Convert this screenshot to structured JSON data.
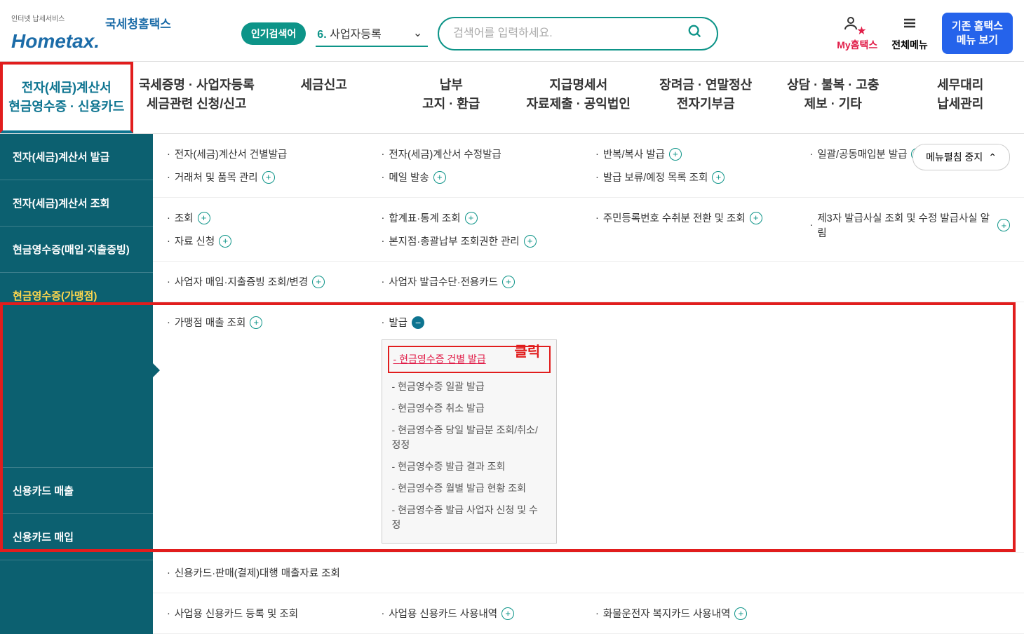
{
  "header": {
    "logo_main": "Hometax.",
    "logo_sub": "국세청홈택스",
    "logo_tag": "인터넷 납세서비스",
    "popular_badge": "인기검색어",
    "keyword_num": "6.",
    "keyword_text": "사업자등록",
    "search_placeholder": "검색어를 입력하세요.",
    "my_label": "My홈택스",
    "all_menu_label": "전체메뉴",
    "old_menu_line1": "기존 홈택스",
    "old_menu_line2": "메뉴 보기"
  },
  "nav": [
    "전자(세금)계산서\n현금영수증 · 신용카드",
    "국세증명 · 사업자등록\n세금관련 신청/신고",
    "세금신고",
    "납부\n고지 · 환급",
    "지급명세서\n자료제출 · 공익법인",
    "장려금 · 연말정산\n전자기부금",
    "상담 · 불복 · 고충\n제보 · 기타",
    "세무대리\n납세관리"
  ],
  "side": [
    "전자(세금)계산서 발급",
    "전자(세금)계산서 조회",
    "현금영수증(매입·지출증빙)",
    "현금영수증(가맹점)",
    "신용카드 매출",
    "신용카드 매입"
  ],
  "rows": {
    "r0": {
      "c0": [
        "전자(세금)계산서 건별발급",
        "거래처 및 품목 관리"
      ],
      "c1": [
        "전자(세금)계산서 수정발급",
        "메일 발송"
      ],
      "c2": [
        "반복/복사 발급",
        "발급 보류/예정 목록 조회"
      ],
      "c3": [
        "일괄/공동매입분 발급"
      ]
    },
    "r1": {
      "c0": [
        "조회",
        "자료 신청"
      ],
      "c1": [
        "합계표·통계 조회",
        "본지점·총괄납부 조회권한 관리"
      ],
      "c2": [
        "주민등록번호 수취분 전환 및 조회"
      ],
      "c3": [
        "제3자 발급사실 조회 및 수정 발급사실 알림"
      ]
    },
    "r2": {
      "c0": [
        "사업자 매입·지출증빙 조회/변경"
      ],
      "c1": [
        "사업자 발급수단·전용카드"
      ]
    },
    "r3": {
      "c0": [
        "가맹점 매출 조회"
      ],
      "c1_head": "발급",
      "dropdown": [
        "현금영수증 건별 발급",
        "현금영수증 일괄 발급",
        "현금영수증 취소 발급",
        "현금영수증 당일 발급분 조회/취소/정정",
        "현금영수증 발급 결과 조회",
        "현금영수증 월별 발급 현황 조회",
        "현금영수증 발급 사업자 신청 및 수정"
      ]
    },
    "r4": {
      "c0": [
        "신용카드·판매(결제)대행 매출자료 조회"
      ]
    },
    "r5": {
      "c0": [
        "사업용 신용카드 등록 및 조회"
      ],
      "c1": [
        "사업용 신용카드 사용내역"
      ],
      "c2": [
        "화물운전자 복지카드 사용내역"
      ]
    }
  },
  "click_label": "클릭",
  "collapse_label": "메뉴펼침 중지"
}
